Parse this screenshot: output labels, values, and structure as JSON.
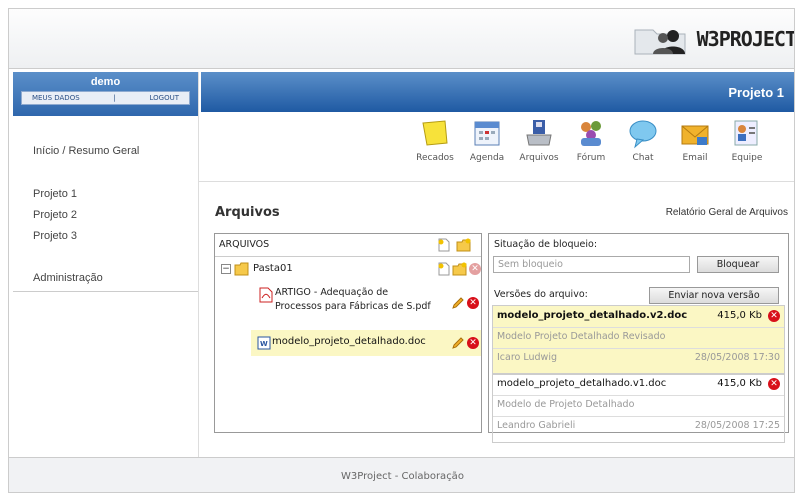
{
  "brand": {
    "logo_text": "W3PROJECT"
  },
  "user": {
    "name": "demo",
    "links": [
      "MEUS DADOS",
      "|",
      "LOGOUT"
    ]
  },
  "project": {
    "title": "Projeto 1"
  },
  "sidebar": {
    "items": [
      {
        "label": "Início / Resumo Geral"
      },
      {
        "label": "Projeto 1"
      },
      {
        "label": "Projeto 2"
      },
      {
        "label": "Projeto 3"
      },
      {
        "label": "Administração"
      }
    ]
  },
  "toolbar": {
    "items": [
      {
        "label": "Recados",
        "icon": "sticky-note-icon"
      },
      {
        "label": "Agenda",
        "icon": "calendar-icon"
      },
      {
        "label": "Arquivos",
        "icon": "files-icon"
      },
      {
        "label": "Fórum",
        "icon": "forum-icon"
      },
      {
        "label": "Chat",
        "icon": "chat-bubble-icon"
      },
      {
        "label": "Email",
        "icon": "email-icon"
      },
      {
        "label": "Equipe",
        "icon": "team-icon"
      }
    ]
  },
  "section": {
    "title": "Arquivos",
    "report_link": "Relatório Geral de Arquivos"
  },
  "files": {
    "header": "ARQUIVOS",
    "folder": "Pasta01",
    "items": [
      {
        "name_line1": "ARTIGO - Adequação de",
        "name_line2": "Processos para Fábricas de S.pdf",
        "type": "pdf"
      },
      {
        "name": "modelo_projeto_detalhado.doc",
        "type": "doc",
        "selected": true
      }
    ]
  },
  "lock": {
    "label": "Situação de bloqueio:",
    "value": "Sem bloqueio",
    "button": "Bloquear"
  },
  "versions": {
    "label": "Versões do arquivo:",
    "new_button": "Enviar nova versão",
    "items": [
      {
        "file": "modelo_projeto_detalhado.v2.doc",
        "size": "415,0 Kb",
        "desc": "Modelo Projeto Detalhado Revisado",
        "author": "Icaro Ludwig",
        "date": "28/05/2008 17:30",
        "active": true
      },
      {
        "file": "modelo_projeto_detalhado.v1.doc",
        "size": "415,0 Kb",
        "desc": "Modelo de Projeto Detalhado",
        "author": "Leandro Gabrieli",
        "date": "28/05/2008 17:25",
        "active": false
      }
    ]
  },
  "footer": {
    "text": "W3Project - Colaboração"
  },
  "colors": {
    "header_blue": "#2f67ad",
    "highlight": "#fbf7c4",
    "delete_red": "#d8101a"
  }
}
